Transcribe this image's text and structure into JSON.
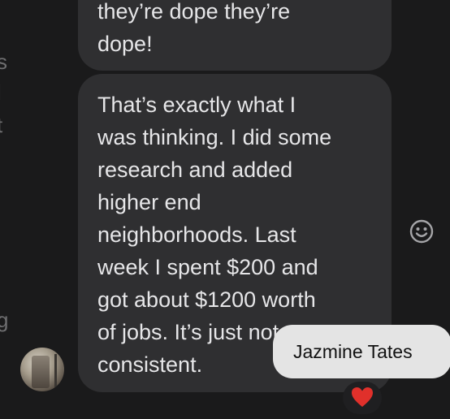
{
  "left_strip": {
    "fragments": [
      "s",
      "l",
      "t",
      "g"
    ]
  },
  "messages": [
    {
      "text": "they’re dope they’re\ndope!"
    },
    {
      "text": "That’s exactly what I\nwas thinking. I did some\nresearch and added\nhigher end\nneighborhoods. Last\nweek I spent $200 and\ngot about $1200 worth\nof jobs.  It’s just not\nconsistent."
    }
  ],
  "tooltip": {
    "name": "Jazmine Tates"
  },
  "reaction": {
    "icon": "heart-icon",
    "color": "#e0302b"
  },
  "actions": {
    "emoji_icon": "smiley-icon",
    "icon_color": "#a5a5a8"
  }
}
